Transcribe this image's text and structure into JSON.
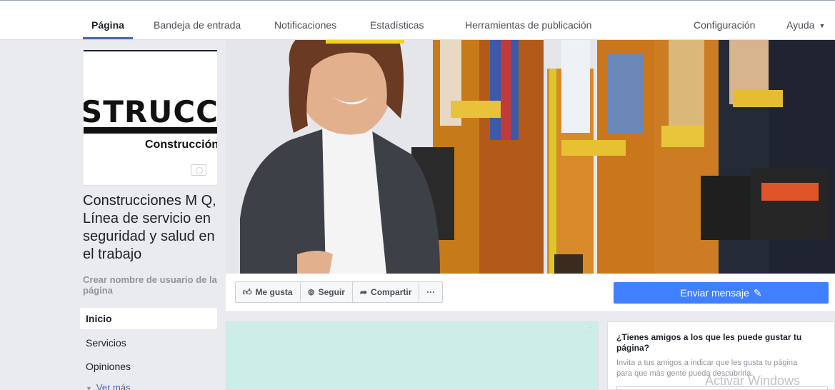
{
  "nav": {
    "tabs": [
      "Página",
      "Bandeja de entrada",
      "Notificaciones",
      "Estadísticas",
      "Herramientas de publicación"
    ],
    "settings": "Configuración",
    "help": "Ayuda",
    "help_caret": "▼"
  },
  "profile": {
    "logo_text": "STRUCCIO",
    "logo_subtext": "Construcción",
    "page_name": "Construcciones M Q, Línea de servicio en seguridad y salud en el trabajo",
    "create_username": "Crear nombre de usuario de la página"
  },
  "sidebar": {
    "items": [
      "Inicio",
      "Servicios",
      "Opiniones"
    ],
    "see_more": "Ver más"
  },
  "actions": {
    "like": "Me gusta",
    "follow": "Seguir",
    "share": "Compartir",
    "more": "···",
    "send_message": "Enviar mensaje"
  },
  "invite": {
    "title": "¿Tienes amigos a los que les puede gustar tu página?",
    "text": "Invita a tus amigos a indicar que les gusta tu página para que más gente pueda descubrirla."
  },
  "watermark": "Activar Windows",
  "colors": {
    "accent": "#4267b2",
    "send_button": "#4080ff",
    "teal_panel": "#cdeee7",
    "background": "#e9ebee"
  },
  "icons": {
    "like": "thumbs-up-icon",
    "follow": "rss-icon",
    "share": "share-arrow-icon",
    "send": "pencil-icon",
    "camera": "camera-icon"
  }
}
